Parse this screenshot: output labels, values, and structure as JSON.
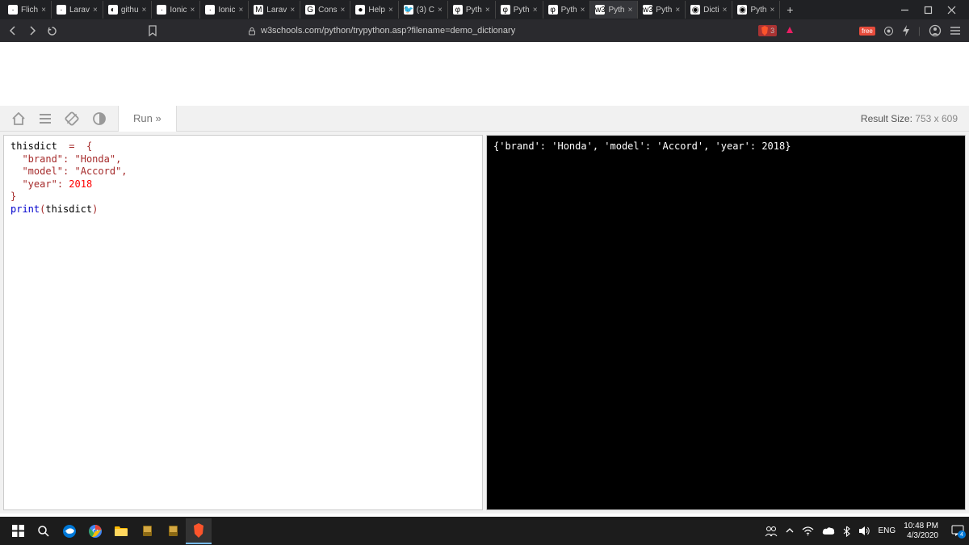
{
  "browser": {
    "tabs": [
      {
        "title": "Flich",
        "favicon": "·"
      },
      {
        "title": "Larav",
        "favicon": "·"
      },
      {
        "title": "githu",
        "favicon": "◐"
      },
      {
        "title": "Ionic",
        "favicon": "·"
      },
      {
        "title": "Ionic",
        "favicon": "·"
      },
      {
        "title": "Larav",
        "favicon": "M"
      },
      {
        "title": "Cons",
        "favicon": "G"
      },
      {
        "title": "Help",
        "favicon": "●"
      },
      {
        "title": "(3) C",
        "favicon": "🐦"
      },
      {
        "title": "Pyth",
        "favicon": "φ"
      },
      {
        "title": "Pyth",
        "favicon": "φ"
      },
      {
        "title": "Pyth",
        "favicon": "φ"
      },
      {
        "title": "Pyth",
        "favicon": "w3",
        "active": true
      },
      {
        "title": "Pyth",
        "favicon": "w3"
      },
      {
        "title": "Dicti",
        "favicon": "◉"
      },
      {
        "title": "Pyth",
        "favicon": "◉"
      }
    ],
    "url": "w3schools.com/python/trypython.asp?filename=demo_dictionary"
  },
  "ws": {
    "run_label": "Run »",
    "result_label": "Result Size:",
    "result_dims": "753 x 609",
    "code_tokens": [
      [
        "plain",
        "thisdict  "
      ],
      [
        "op",
        "="
      ],
      [
        "plain",
        "  "
      ],
      [
        "op",
        "{"
      ],
      [
        "nl",
        ""
      ],
      [
        "plain",
        "  "
      ],
      [
        "str",
        "\"brand\""
      ],
      [
        "op",
        ":"
      ],
      [
        "plain",
        " "
      ],
      [
        "str",
        "\"Honda\""
      ],
      [
        "op",
        ","
      ],
      [
        "nl",
        ""
      ],
      [
        "plain",
        "  "
      ],
      [
        "str",
        "\"model\""
      ],
      [
        "op",
        ":"
      ],
      [
        "plain",
        " "
      ],
      [
        "str",
        "\"Accord\""
      ],
      [
        "op",
        ","
      ],
      [
        "nl",
        ""
      ],
      [
        "plain",
        "  "
      ],
      [
        "str",
        "\"year\""
      ],
      [
        "op",
        ":"
      ],
      [
        "plain",
        " "
      ],
      [
        "num",
        "2018"
      ],
      [
        "nl",
        ""
      ],
      [
        "op",
        "}"
      ],
      [
        "nl",
        ""
      ],
      [
        "fn",
        "print"
      ],
      [
        "op",
        "("
      ],
      [
        "plain",
        "thisdict"
      ],
      [
        "op",
        ")"
      ]
    ],
    "output": "{'brand': 'Honda', 'model': 'Accord', 'year': 2018}"
  },
  "taskbar": {
    "lang": "ENG",
    "time": "10:48 PM",
    "date": "4/3/2020",
    "notif_count": "4"
  },
  "nav_right": {
    "brave_count": "3",
    "free_label": "free"
  }
}
